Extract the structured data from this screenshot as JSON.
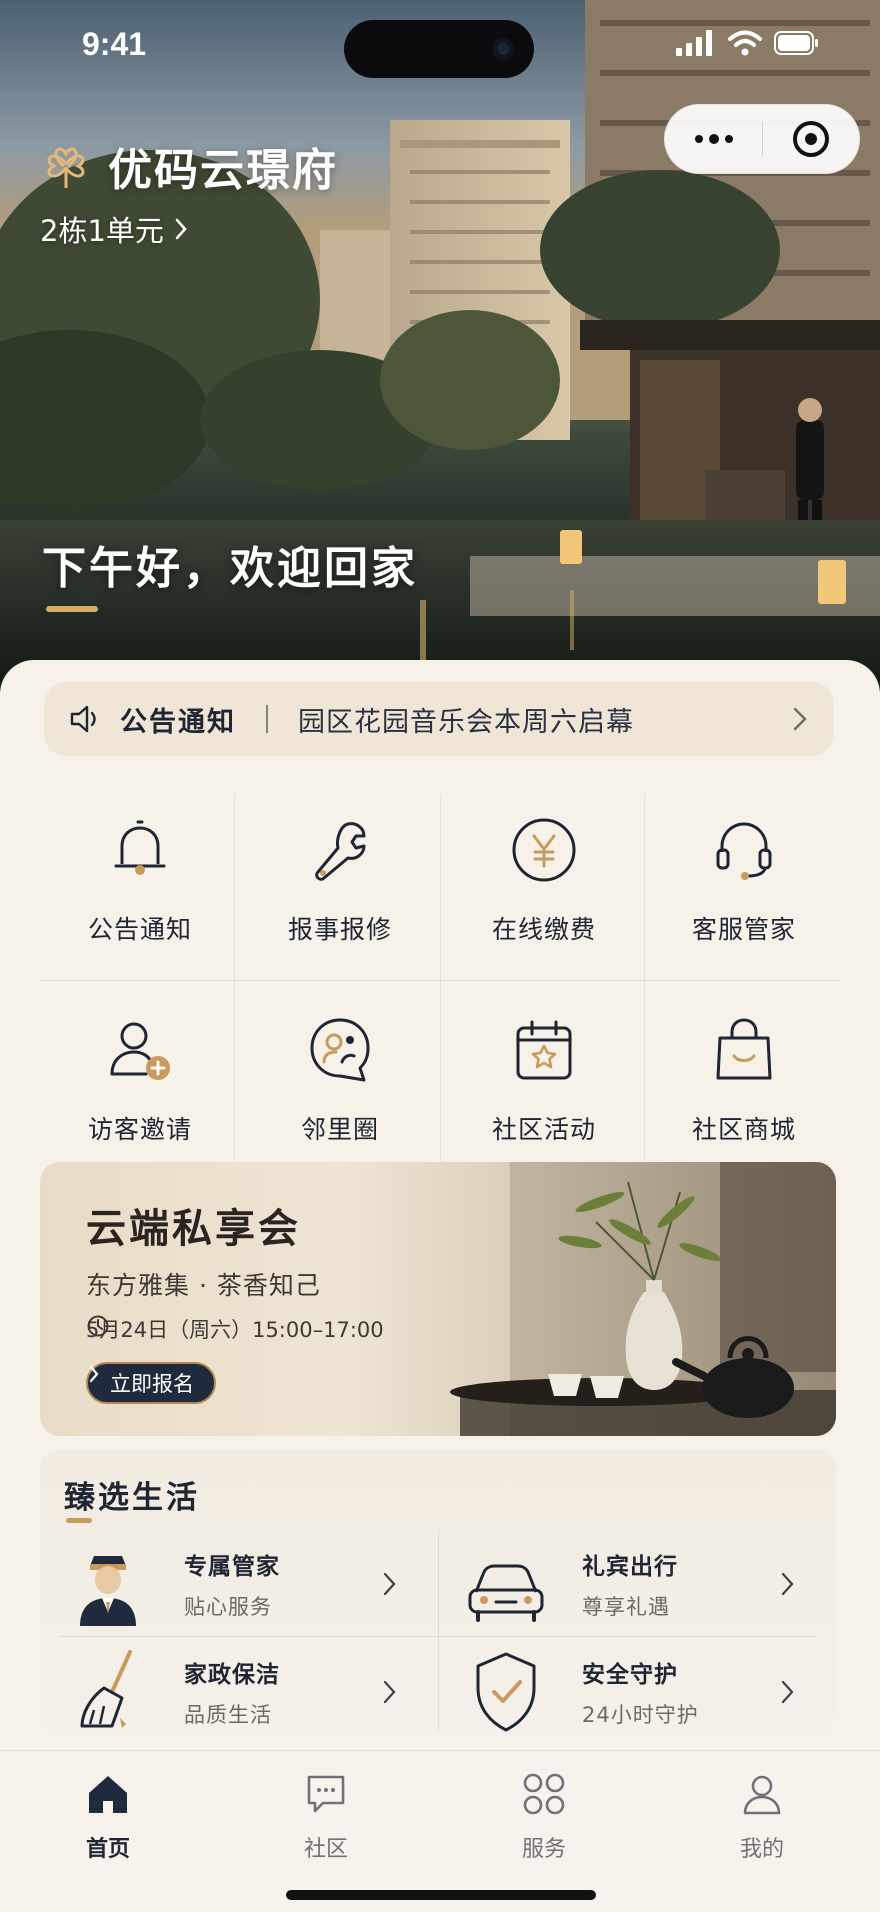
{
  "status": {
    "time": "9:41"
  },
  "header": {
    "title": "优码云璟府",
    "building": "2栋1单元"
  },
  "greeting": "下午好，欢迎回家",
  "notice": {
    "label": "公告通知",
    "text": "园区花园音乐会本周六启幕"
  },
  "grid": {
    "items": [
      {
        "label": "公告通知",
        "icon": "bell-icon"
      },
      {
        "label": "报事报修",
        "icon": "wrench-icon"
      },
      {
        "label": "在线缴费",
        "icon": "yen-icon"
      },
      {
        "label": "客服管家",
        "icon": "headset-icon"
      },
      {
        "label": "访客邀请",
        "icon": "user-plus-icon"
      },
      {
        "label": "邻里圈",
        "icon": "neighbor-chat-icon"
      },
      {
        "label": "社区活动",
        "icon": "calendar-star-icon"
      },
      {
        "label": "社区商城",
        "icon": "shopping-bag-icon"
      }
    ]
  },
  "banner": {
    "title": "云端私享会",
    "subtitle": "东方雅集 · 茶香知己",
    "time": "5月24日（周六）15:00–17:00",
    "button": "立即报名"
  },
  "curated": {
    "title": "臻选生活",
    "items": [
      {
        "name": "专属管家",
        "desc": "贴心服务",
        "icon": "butler-icon"
      },
      {
        "name": "礼宾出行",
        "desc": "尊享礼遇",
        "icon": "car-icon"
      },
      {
        "name": "家政保洁",
        "desc": "品质生活",
        "icon": "broom-icon"
      },
      {
        "name": "安全守护",
        "desc": "24小时守护",
        "icon": "shield-check-icon"
      }
    ]
  },
  "tabbar": {
    "tabs": [
      {
        "label": "首页",
        "icon": "home-icon",
        "active": true
      },
      {
        "label": "社区",
        "icon": "chat-icon",
        "active": false
      },
      {
        "label": "服务",
        "icon": "grid-icon",
        "active": false
      },
      {
        "label": "我的",
        "icon": "profile-icon",
        "active": false
      }
    ]
  },
  "colors": {
    "accent_gold": "#c89a5b",
    "navy": "#1f2532",
    "background": "#f6f2ea"
  }
}
